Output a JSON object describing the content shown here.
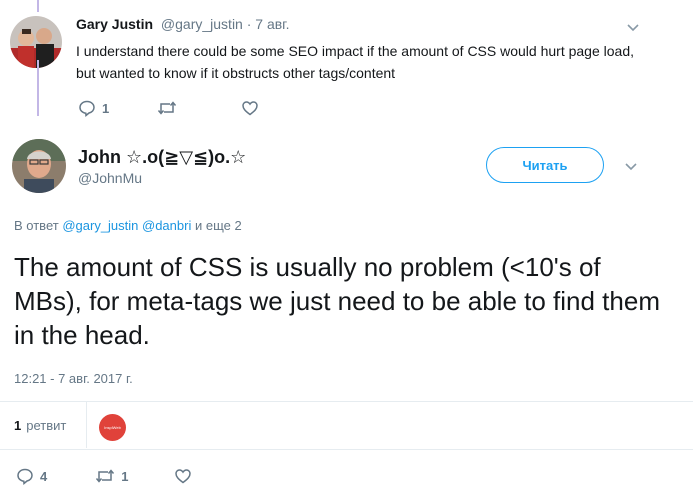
{
  "reply": {
    "author_name": "Gary Justin",
    "author_meta": "@gary_justin · 7 авг.",
    "text": "I understand there could be some SEO impact if the amount of CSS would hurt page load, but wanted to know if it obstructs other tags/content",
    "reply_count": "1",
    "retweet_count": "",
    "like_count": ""
  },
  "main": {
    "author_name": "John ☆.o(≧▽≦)o.☆",
    "author_handle": "@JohnMu",
    "follow_label": "Читать",
    "in_reply_prefix": "В ответ",
    "in_reply_mentions": "@gary_justin @danbri",
    "in_reply_suffix": "и еще 2",
    "text": "The amount of CSS is usually no problem (<10's of MBs), for meta-tags we just need to be able to find them in the head.",
    "timestamp": "12:21 - 7 авг. 2017 г.",
    "retweets_count": "1",
    "retweets_label": "ретвит",
    "retweeter_badge": "InspiWeb",
    "reply_count": "4",
    "retweet_count": "1",
    "like_count": ""
  },
  "icons": {
    "reply": "reply-icon",
    "retweet": "retweet-icon",
    "like": "heart-icon",
    "menu": "chevron-down-icon"
  },
  "colors": {
    "accent": "#1da1f2",
    "mention": "#1b95e0",
    "muted": "#657786",
    "thread_line": "#c3b7e6"
  }
}
